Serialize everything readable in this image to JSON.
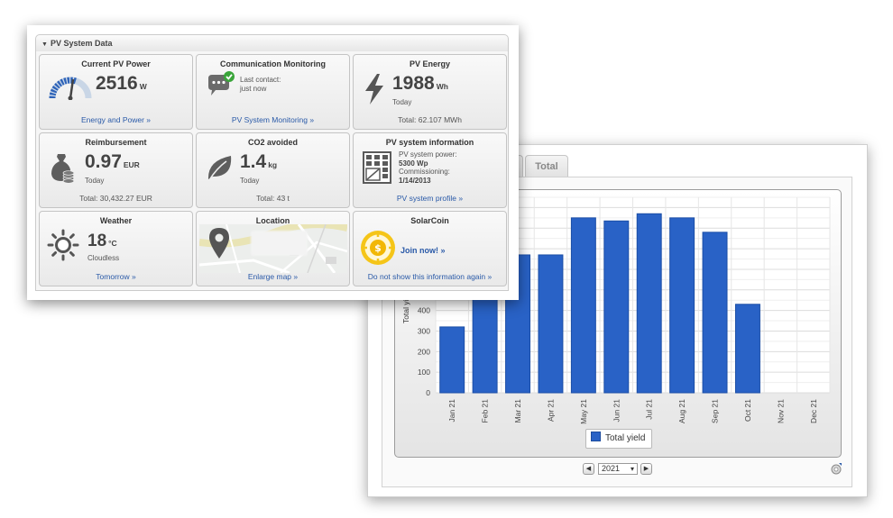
{
  "pv_widget": {
    "header": "PV System Data",
    "tiles": {
      "current_power": {
        "title": "Current PV Power",
        "value": "2516",
        "unit": "W",
        "footer": "Energy and Power »"
      },
      "comm_monitoring": {
        "title": "Communication Monitoring",
        "line1": "Last contact:",
        "line2": "just now",
        "footer": "PV System Monitoring »"
      },
      "pv_energy": {
        "title": "PV Energy",
        "value": "1988",
        "unit": "Wh",
        "sub": "Today",
        "footer": "Total: 62.107 MWh"
      },
      "reimbursement": {
        "title": "Reimbursement",
        "value": "0.97",
        "unit": "EUR",
        "sub": "Today",
        "footer": "Total: 30,432.27 EUR"
      },
      "co2": {
        "title": "CO2 avoided",
        "value": "1.4",
        "unit": "kg",
        "sub": "Today",
        "footer": "Total: 43 t"
      },
      "system_info": {
        "title": "PV system information",
        "power_label": "PV system power:",
        "power_value": "5300 Wp",
        "comm_label": "Commissioning:",
        "comm_value": "1/14/2013",
        "footer": "PV system profile »"
      },
      "weather": {
        "title": "Weather",
        "value": "18",
        "unit": "°C",
        "sub": "Cloudless",
        "footer": "Tomorrow »"
      },
      "location": {
        "title": "Location",
        "footer": "Enlarge map »"
      },
      "solarcoin": {
        "title": "SolarCoin",
        "cta": "Join now! »",
        "footer": "Do not show this information again »"
      }
    }
  },
  "chart_window": {
    "tab_total": "Total",
    "legend_label": "Total yield",
    "year_selected": "2021",
    "prev_symbol": "◀",
    "next_symbol": "▶",
    "caret": "▾"
  },
  "colors": {
    "bar": "#2962c6",
    "bar_edge": "#1b4ea6",
    "link": "#2a5aa8",
    "check": "#3aa53a",
    "solarcoin": "#f2b705"
  },
  "chart_data": {
    "type": "bar",
    "categories": [
      "Jan 21",
      "Feb 21",
      "Mar 21",
      "Apr 21",
      "May 21",
      "Jun 21",
      "Jul 21",
      "Aug 21",
      "Sep 21",
      "Oct 21",
      "Nov 21",
      "Dec 21"
    ],
    "series": [
      {
        "name": "Total yield",
        "values": [
          320,
          610,
          670,
          670,
          850,
          835,
          870,
          850,
          780,
          430,
          null,
          null
        ]
      }
    ],
    "ylabel": "Total yie",
    "yticks": [
      0,
      100,
      200,
      300,
      400
    ],
    "ylim": [
      0,
      950
    ],
    "grid": true,
    "legend": "bottom-center"
  }
}
